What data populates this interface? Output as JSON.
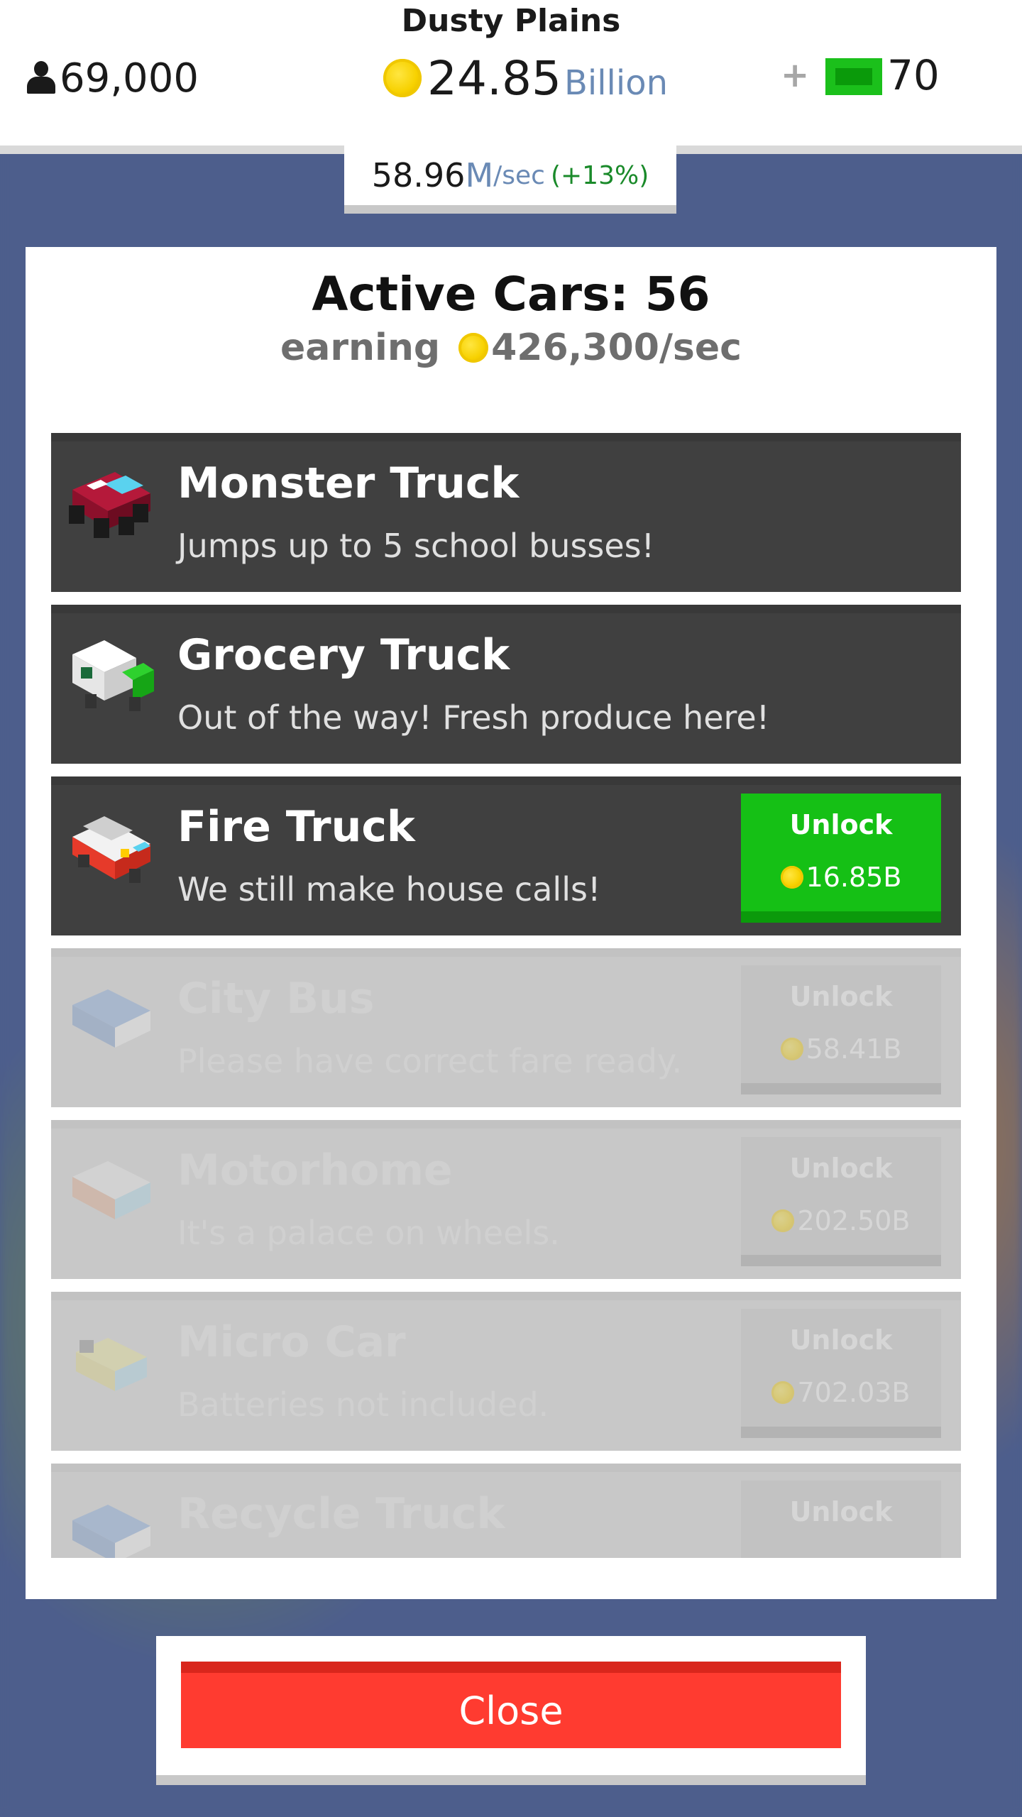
{
  "header": {
    "level_name": "Dusty Plains",
    "population": "69,000",
    "money_value": "24.85",
    "money_unit": "Billion",
    "plus_label": "+",
    "gems": "70",
    "icons": {
      "population": "person-icon",
      "money": "coin-icon",
      "gems": "cash-icon"
    }
  },
  "rate": {
    "value": "58.96",
    "unit": "M",
    "per": "/sec",
    "bonus": "(+13%)"
  },
  "panel": {
    "title": "Active Cars: 56",
    "earning_label": "earning",
    "earning_value": "426,300/sec"
  },
  "cars": [
    {
      "name": "Monster Truck",
      "desc": "Jumps up to 5 school busses!",
      "state": "owned",
      "icon": "monster-truck-icon"
    },
    {
      "name": "Grocery Truck",
      "desc": "Out of the way! Fresh produce here!",
      "state": "owned",
      "icon": "grocery-truck-icon"
    },
    {
      "name": "Fire Truck",
      "desc": "We still make house calls!",
      "state": "available",
      "unlock_label": "Unlock",
      "price": "16.85B",
      "icon": "fire-truck-icon"
    },
    {
      "name": "City Bus",
      "desc": "Please have correct fare ready.",
      "state": "locked",
      "unlock_label": "Unlock",
      "price": "58.41B",
      "icon": "city-bus-icon"
    },
    {
      "name": "Motorhome",
      "desc": "It's a palace on wheels.",
      "state": "locked",
      "unlock_label": "Unlock",
      "price": "202.50B",
      "icon": "motorhome-icon"
    },
    {
      "name": "Micro Car",
      "desc": "Batteries not included.",
      "state": "locked",
      "unlock_label": "Unlock",
      "price": "702.03B",
      "icon": "micro-car-icon"
    },
    {
      "name": "Recycle Truck",
      "desc": "",
      "state": "locked",
      "unlock_label": "Unlock",
      "price": "",
      "icon": "recycle-truck-icon"
    }
  ],
  "close_label": "Close",
  "colors": {
    "unlock_green": "#15c015",
    "close_red": "#ff3b30",
    "row_dark": "#404040",
    "row_locked": "#c8c8c8"
  }
}
